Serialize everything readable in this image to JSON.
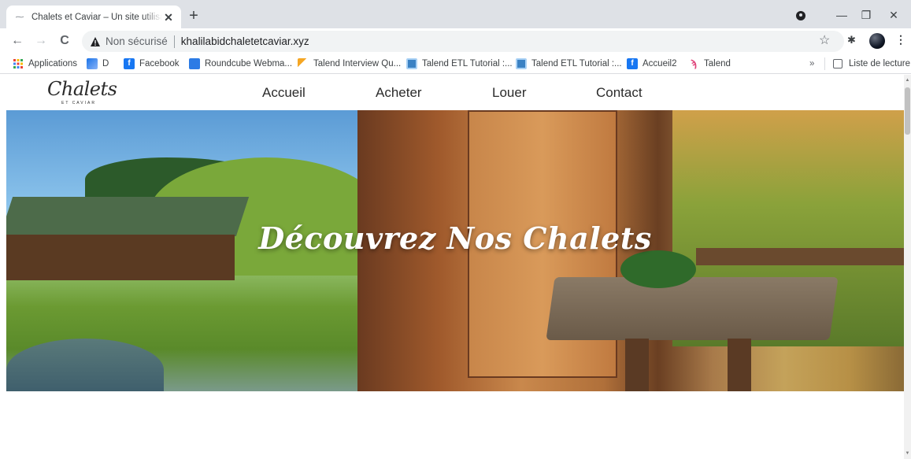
{
  "browser": {
    "tab_title": "Chalets et Caviar – Un site utilisant",
    "tab_close": "✕",
    "new_tab": "+",
    "insecure_label": "Non sécurisé",
    "url": "khalilabidchaletetcaviar.xyz",
    "controls": {
      "minimize": "—",
      "restore": "❐",
      "close": "✕"
    },
    "nav": {
      "back": "←",
      "forward": "→",
      "reload": "C"
    }
  },
  "bookmarks": {
    "items": [
      {
        "label": "Applications",
        "icon": "apps-grid-icon"
      },
      {
        "label": "D",
        "icon": "drive-icon"
      },
      {
        "label": "Facebook",
        "icon": "facebook-icon"
      },
      {
        "label": "Roundcube Webma...",
        "icon": "roundcube-icon"
      },
      {
        "label": "Talend Interview Qu...",
        "icon": "talend-icon"
      },
      {
        "label": "Talend ETL Tutorial :...",
        "icon": "tutorial-icon"
      },
      {
        "label": "Talend ETL Tutorial :...",
        "icon": "tutorial-icon"
      },
      {
        "label": "Accueil2",
        "icon": "facebook-icon"
      },
      {
        "label": "Talend",
        "icon": "talend-logo-icon"
      }
    ],
    "overflow": "»",
    "reading_list": "Liste de lecture"
  },
  "site": {
    "logo_text": "Chalets",
    "logo_sub": "ET CAVIAR",
    "nav": [
      "Accueil",
      "Acheter",
      "Louer",
      "Contact"
    ],
    "hero_title": "Découvrez Nos Chalets"
  },
  "colors": {
    "tab_strip": "#dee1e6",
    "omnibox": "#f1f3f4",
    "hero_text": "#ffffff",
    "nav_text": "#2b2b2b"
  }
}
